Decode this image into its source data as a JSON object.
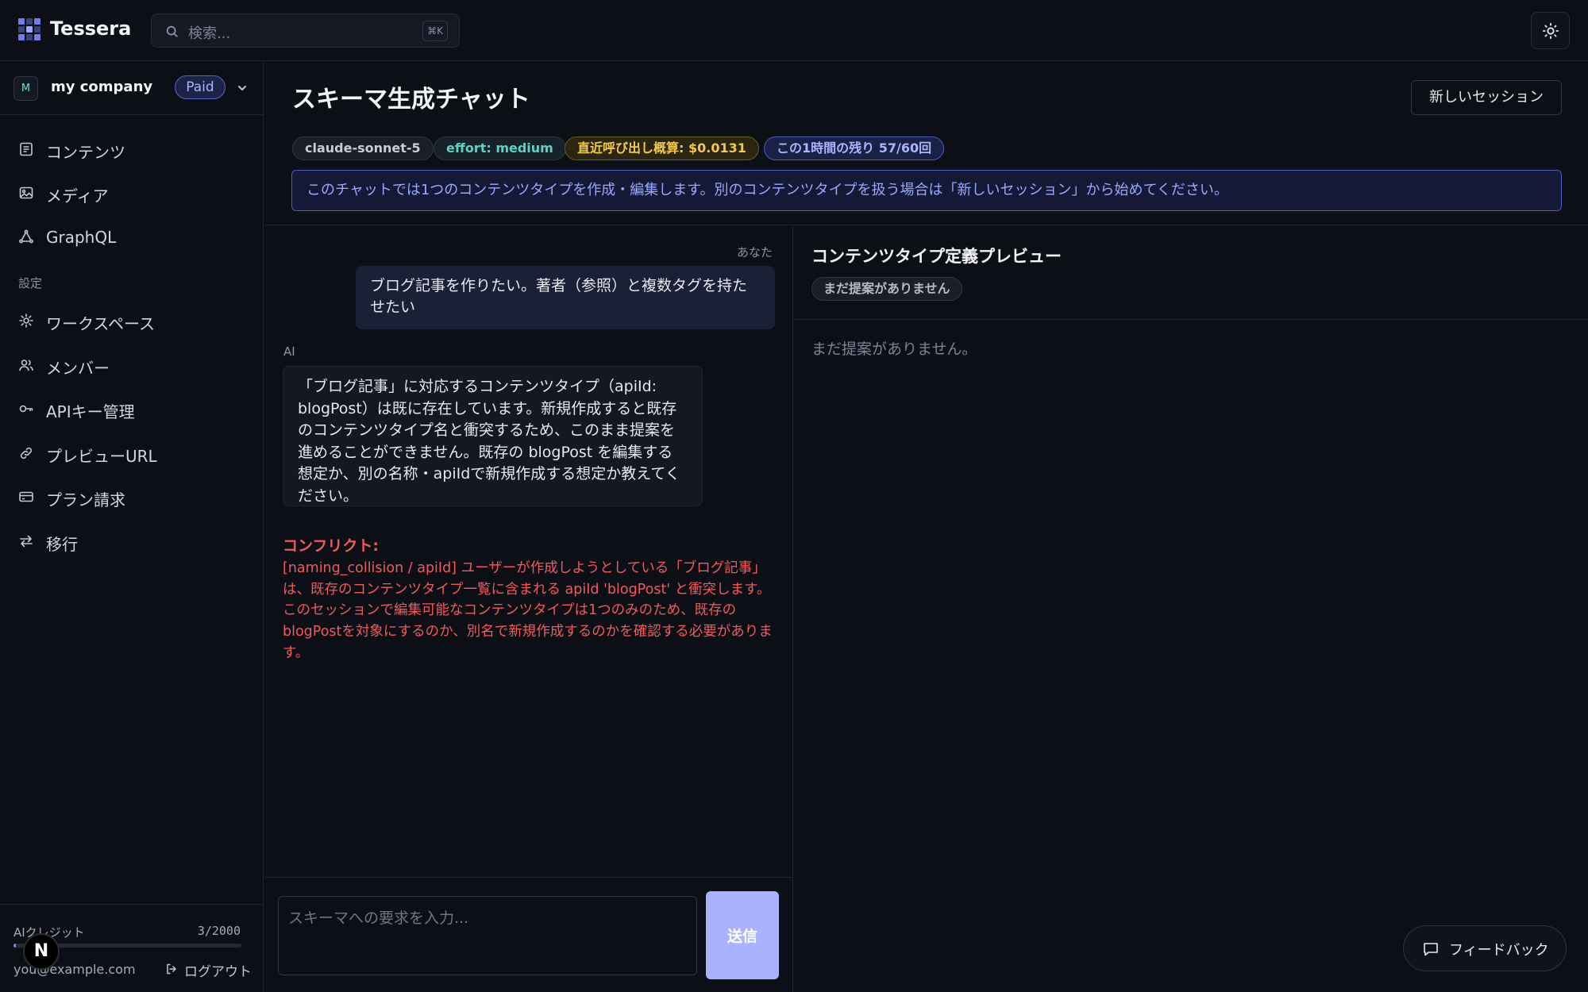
{
  "app": {
    "name": "Tessera"
  },
  "search": {
    "placeholder": "検索...",
    "shortcut": "⌘K"
  },
  "org": {
    "avatar": "M",
    "name": "my company",
    "plan": "Paid"
  },
  "sidebar": {
    "items": [
      {
        "label": "コンテンツ",
        "icon": "document-icon"
      },
      {
        "label": "メディア",
        "icon": "image-icon"
      },
      {
        "label": "GraphQL",
        "icon": "graph-icon"
      }
    ],
    "settings_label": "設定",
    "settings_items": [
      {
        "label": "ワークスペース",
        "icon": "gear-icon"
      },
      {
        "label": "メンバー",
        "icon": "users-icon"
      },
      {
        "label": "APIキー管理",
        "icon": "key-icon"
      },
      {
        "label": "プレビューURL",
        "icon": "link-icon"
      },
      {
        "label": "プラン請求",
        "icon": "credit-card-icon"
      },
      {
        "label": "移行",
        "icon": "arrows-swap-icon"
      }
    ],
    "credits_label": "AIクレジット",
    "credits_value": "3/2000",
    "credits_fraction": 0.0015,
    "user_email": "you@example.com",
    "logout_label": "ログアウト"
  },
  "header": {
    "title": "スキーマ生成チャット",
    "new_session_label": "新しいセッション",
    "tags": {
      "model": "claude-sonnet-5",
      "effort": "effort: medium",
      "cost": "直近呼び出し概算: $0.0131",
      "rate": "この1時間の残り 57/60回"
    },
    "notice": "このチャットでは1つのコンテンツタイプを作成・編集します。別のコンテンツタイプを扱う場合は「新しいセッション」から始めてください。"
  },
  "chat": {
    "you_label": "あなた",
    "user_message": "ブログ記事を作りたい。著者（参照）と複数タグを持たせたい",
    "ai_label": "AI",
    "ai_message": "「ブログ記事」に対応するコンテンツタイプ（apiId: blogPost）は既に存在しています。新規作成すると既存のコンテンツタイプ名と衝突するため、このまま提案を進めることができません。既存の blogPost を編集する想定か、別の名称・apiIdで新規作成する想定か教えてください。",
    "conflict_title": "コンフリクト:",
    "conflict_body": "[naming_collision / apiId] ユーザーが作成しようとしている「ブログ記事」は、既存のコンテンツタイプ一覧に含まれる apiId 'blogPost' と衝突します。このセッションで編集可能なコンテンツタイプは1つのみのため、既存のblogPostを対象にするのか、別名で新規作成するのかを確認する必要があります。",
    "input_placeholder": "スキーマへの要求を入力...",
    "send_label": "送信"
  },
  "preview": {
    "title": "コンテンツタイプ定義プレビュー",
    "badge": "まだ提案がありません",
    "empty": "まだ提案がありません。"
  },
  "feedback_label": "フィードバック",
  "colors": {
    "accent": "#a9b2ff",
    "conflict": "#f25a5a",
    "background": "#0c0f16"
  }
}
